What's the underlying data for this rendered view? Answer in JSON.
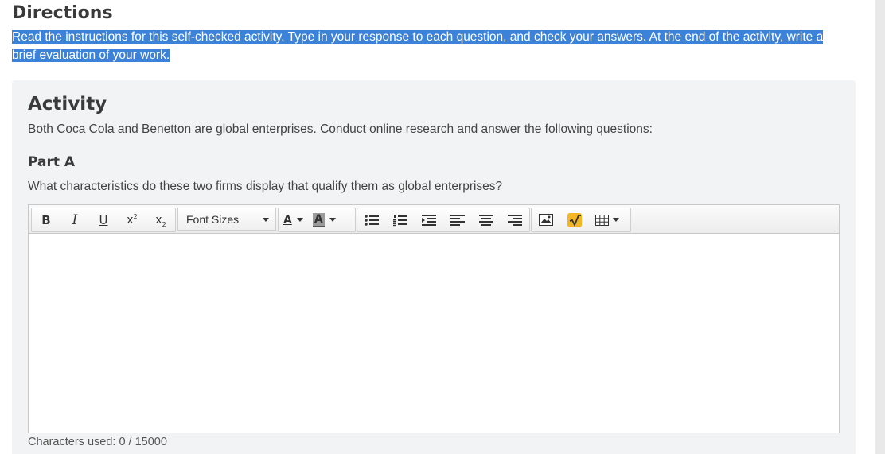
{
  "directions": {
    "title": "Directions",
    "line1": "Read the instructions for this self-checked activity. Type in your response to each question, and check your answers. At the end of the activity, write a",
    "line2": "brief evaluation of your work."
  },
  "activity": {
    "title": "Activity",
    "intro": "Both Coca Cola and Benetton are global enterprises. Conduct online research and answer the following questions:",
    "part_title": "Part A",
    "question": "What characteristics do these two firms display that qualify them as global enterprises?",
    "editor": {
      "toolbar": {
        "bold": "B",
        "italic": "I",
        "underline": "U",
        "superscript_base": "x",
        "superscript_mark": "2",
        "subscript_base": "x",
        "subscript_mark": "2",
        "font_sizes_label": "Font Sizes",
        "font_color_letter": "A",
        "highlight_letter": "A",
        "icons": [
          "bold-icon",
          "italic-icon",
          "underline-icon",
          "superscript-icon",
          "subscript-icon",
          "font-color-icon",
          "highlight-color-icon",
          "bullet-list-icon",
          "numbered-list-icon",
          "indent-icon",
          "align-left-icon",
          "align-center-icon",
          "align-right-icon",
          "image-icon",
          "math-sqrt-icon",
          "table-icon"
        ]
      },
      "content": ""
    },
    "char_count_label": "Characters used: 0 / 15000"
  },
  "colors": {
    "selection": "#3b82d8",
    "panel_bg": "#f2f3f4",
    "math_icon": "#f4b623"
  }
}
